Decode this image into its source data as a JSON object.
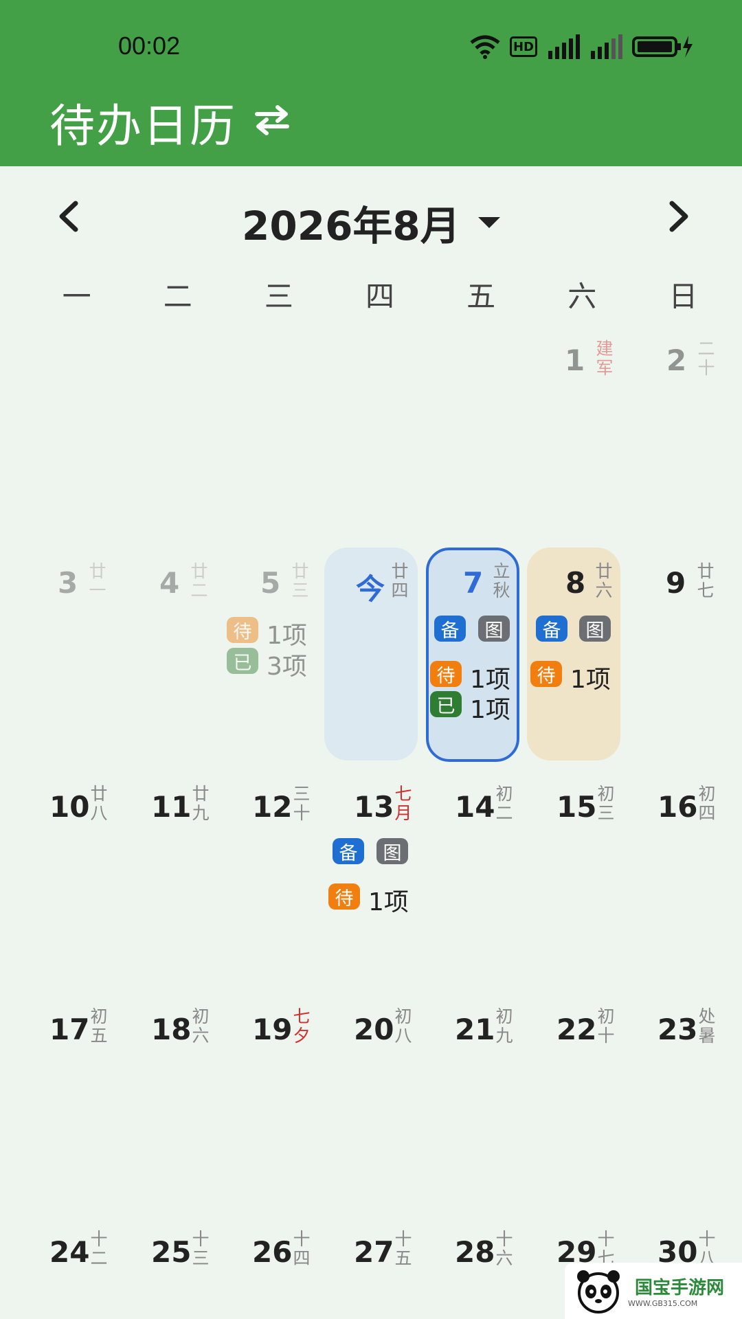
{
  "status": {
    "time": "00:02",
    "hd": "HD"
  },
  "app": {
    "title": "待办日历"
  },
  "month": {
    "title": "2026年8月"
  },
  "weekdays": [
    "一",
    "二",
    "三",
    "四",
    "五",
    "六",
    "日"
  ],
  "days": {
    "d1": {
      "num": "1",
      "lunar": "建军"
    },
    "d2": {
      "num": "2",
      "lunar": "二十"
    },
    "d3": {
      "num": "3",
      "lunar": "廿一"
    },
    "d4": {
      "num": "4",
      "lunar": "廿二"
    },
    "d5": {
      "num": "5",
      "lunar": "廿三"
    },
    "d6": {
      "num": "今",
      "lunar": "廿四"
    },
    "d7": {
      "num": "7",
      "lunar": "立秋"
    },
    "d8": {
      "num": "8",
      "lunar": "廿六"
    },
    "d9": {
      "num": "9",
      "lunar": "廿七"
    },
    "d10": {
      "num": "10",
      "lunar": "廿八"
    },
    "d11": {
      "num": "11",
      "lunar": "廿九"
    },
    "d12": {
      "num": "12",
      "lunar": "三十"
    },
    "d13": {
      "num": "13",
      "lunar": "七月"
    },
    "d14": {
      "num": "14",
      "lunar": "初二"
    },
    "d15": {
      "num": "15",
      "lunar": "初三"
    },
    "d16": {
      "num": "16",
      "lunar": "初四"
    },
    "d17": {
      "num": "17",
      "lunar": "初五"
    },
    "d18": {
      "num": "18",
      "lunar": "初六"
    },
    "d19": {
      "num": "19",
      "lunar": "七夕"
    },
    "d20": {
      "num": "20",
      "lunar": "初八"
    },
    "d21": {
      "num": "21",
      "lunar": "初九"
    },
    "d22": {
      "num": "22",
      "lunar": "初十"
    },
    "d23": {
      "num": "23",
      "lunar": "处暑"
    },
    "d24": {
      "num": "24",
      "lunar": "十二"
    },
    "d25": {
      "num": "25",
      "lunar": "十三"
    },
    "d26": {
      "num": "26",
      "lunar": "十四"
    },
    "d27": {
      "num": "27",
      "lunar": "十五"
    },
    "d28": {
      "num": "28",
      "lunar": "十六"
    },
    "d29": {
      "num": "29",
      "lunar": "十七"
    },
    "d30": {
      "num": "30",
      "lunar": "十八"
    }
  },
  "tags": {
    "bei": "备",
    "tu": "图",
    "dai": "待",
    "yi": "已"
  },
  "counts": {
    "d5_dai": "1项",
    "d5_yi": "3项",
    "d7_dai": "1项",
    "d7_yi": "1项",
    "d8_dai": "1项",
    "d13_dai": "1项"
  },
  "watermark": {
    "brand": "国宝手游网",
    "url": "WWW.GB315.COM"
  },
  "colors": {
    "appbar": "#43a047",
    "accent": "#2f6bd6",
    "pending": "#f07f10",
    "done": "#2e7d32"
  }
}
